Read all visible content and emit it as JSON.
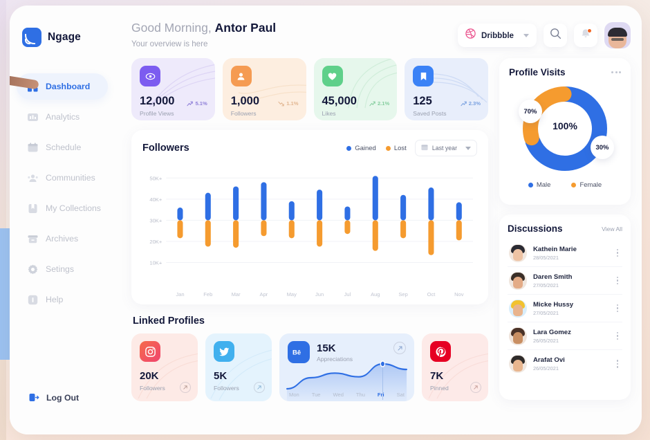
{
  "brand": {
    "name": "Ngage",
    "logo_icon": "signal-logo-icon"
  },
  "sidebar": {
    "items": [
      {
        "label": "Dashboard",
        "icon": "grid-icon",
        "active": true
      },
      {
        "label": "Analytics",
        "icon": "bar-chart-icon",
        "active": false
      },
      {
        "label": "Schedule",
        "icon": "calendar-icon",
        "active": false
      },
      {
        "label": "Communities",
        "icon": "people-icon",
        "active": false
      },
      {
        "label": "My Collections",
        "icon": "bookmark-icon",
        "active": false
      },
      {
        "label": "Archives",
        "icon": "archive-icon",
        "active": false
      },
      {
        "label": "Setings",
        "icon": "gear-icon",
        "active": false
      },
      {
        "label": "Help",
        "icon": "help-icon",
        "active": false
      }
    ],
    "logout": {
      "label": "Log Out",
      "icon": "logout-icon"
    }
  },
  "header": {
    "greeting_prefix": "Good Morning,",
    "user_name": "Antor Paul",
    "subtitle": "Your overview is here",
    "source_selector": {
      "label": "Dribbble",
      "icon": "dribbble-icon"
    },
    "search_icon": "search-icon",
    "notification_icon": "bell-icon",
    "has_notification": true,
    "avatar_icon": "user-avatar"
  },
  "stats": [
    {
      "value": "12,000",
      "label": "Profile Views",
      "change": "5.1%",
      "direction": "up",
      "icon": "eye-icon",
      "accent": "#7c5cf0"
    },
    {
      "value": "1,000",
      "label": "Followers",
      "change": "1.1%",
      "direction": "down",
      "icon": "users-icon",
      "accent": "#f59b52"
    },
    {
      "value": "45,000",
      "label": "Likes",
      "change": "2.1%",
      "direction": "up",
      "icon": "heart-icon",
      "accent": "#5fd08a"
    },
    {
      "value": "125",
      "label": "Saved Posts",
      "change": "2.3%",
      "direction": "up",
      "icon": "bookmark-icon",
      "accent": "#3b82f6"
    }
  ],
  "followers_panel": {
    "title": "Followers",
    "legend": [
      {
        "label": "Gained",
        "color": "#2f6fe4"
      },
      {
        "label": "Lost",
        "color": "#f59b2f"
      }
    ],
    "period": {
      "label": "Last year",
      "icon": "calendar-icon"
    }
  },
  "chart_data": {
    "type": "bar",
    "title": "Followers",
    "xlabel": "",
    "ylabel": "",
    "ylim": [
      0,
      55000
    ],
    "grid": true,
    "legend_position": "top-right",
    "categories": [
      "Jan",
      "Feb",
      "Mar",
      "Apr",
      "May",
      "Jun",
      "Jul",
      "Aug",
      "Sep",
      "Oct",
      "Nov"
    ],
    "tick_labels": [
      "10K+",
      "20K+",
      "30K+",
      "40K+",
      "50K+"
    ],
    "tick_values": [
      10000,
      20000,
      30000,
      40000,
      50000
    ],
    "note": "Floating stacked bars: each bar spans from its Lost low to its Gained high, split at 30K.",
    "split_value": 30000,
    "series": [
      {
        "name": "Gained",
        "color": "#2f6fe4",
        "values": [
          36000,
          43000,
          46000,
          48000,
          39000,
          44500,
          36500,
          51000,
          42000,
          45500,
          38500
        ]
      },
      {
        "name": "Lost",
        "color": "#f59b2f",
        "values": [
          21500,
          17500,
          17000,
          22500,
          21500,
          17500,
          23500,
          15500,
          21500,
          13500,
          20500
        ]
      }
    ]
  },
  "linked_profiles": {
    "title": "Linked Profiles",
    "items": [
      {
        "network": "Instagram",
        "icon": "instagram-icon",
        "value": "20K",
        "label": "Followers",
        "type": "small"
      },
      {
        "network": "Twitter",
        "icon": "twitter-icon",
        "value": "5K",
        "label": "Followers",
        "type": "small"
      },
      {
        "network": "Behance",
        "icon": "behance-icon",
        "value": "15K",
        "label": "Appreciations",
        "type": "wide"
      },
      {
        "network": "Pinterest",
        "icon": "pinterest-icon",
        "value": "7K",
        "label": "Pinned",
        "type": "small"
      }
    ],
    "behance_chart": {
      "type": "area",
      "days": [
        "Mon",
        "Tue",
        "Wed",
        "Thu",
        "Fri",
        "Sat"
      ],
      "active_day": "Fri",
      "values": [
        18,
        42,
        52,
        44,
        72,
        60
      ],
      "color": "#2f6fe4"
    }
  },
  "profile_visits": {
    "title": "Profile Visits",
    "center_label": "100%",
    "menu_icon": "more-horizontal-icon",
    "segments": [
      {
        "label": "Male",
        "percent": "70%",
        "value": 70,
        "color": "#2f6fe4"
      },
      {
        "label": "Female",
        "percent": "30%",
        "value": 30,
        "color": "#f59b2f"
      }
    ]
  },
  "discussions": {
    "title": "Discussions",
    "view_all": "View All",
    "items": [
      {
        "name": "Kathein Marie",
        "date": "28/05/2021",
        "hair": "#2b2b33",
        "skin": "#eec3a4"
      },
      {
        "name": "Daren Smith",
        "date": "27/05/2021",
        "hair": "#3a2f28",
        "skin": "#e3ab86"
      },
      {
        "name": "Micke Hussy",
        "date": "27/05/2021",
        "hair": "#f2c230",
        "skin": "#e9b48d"
      },
      {
        "name": "Lara Gomez",
        "date": "26/05/2021",
        "hair": "#4a3228",
        "skin": "#c98f63"
      },
      {
        "name": "Arafat Ovi",
        "date": "26/05/2021",
        "hair": "#2e2b2a",
        "skin": "#e8b68f"
      }
    ]
  }
}
